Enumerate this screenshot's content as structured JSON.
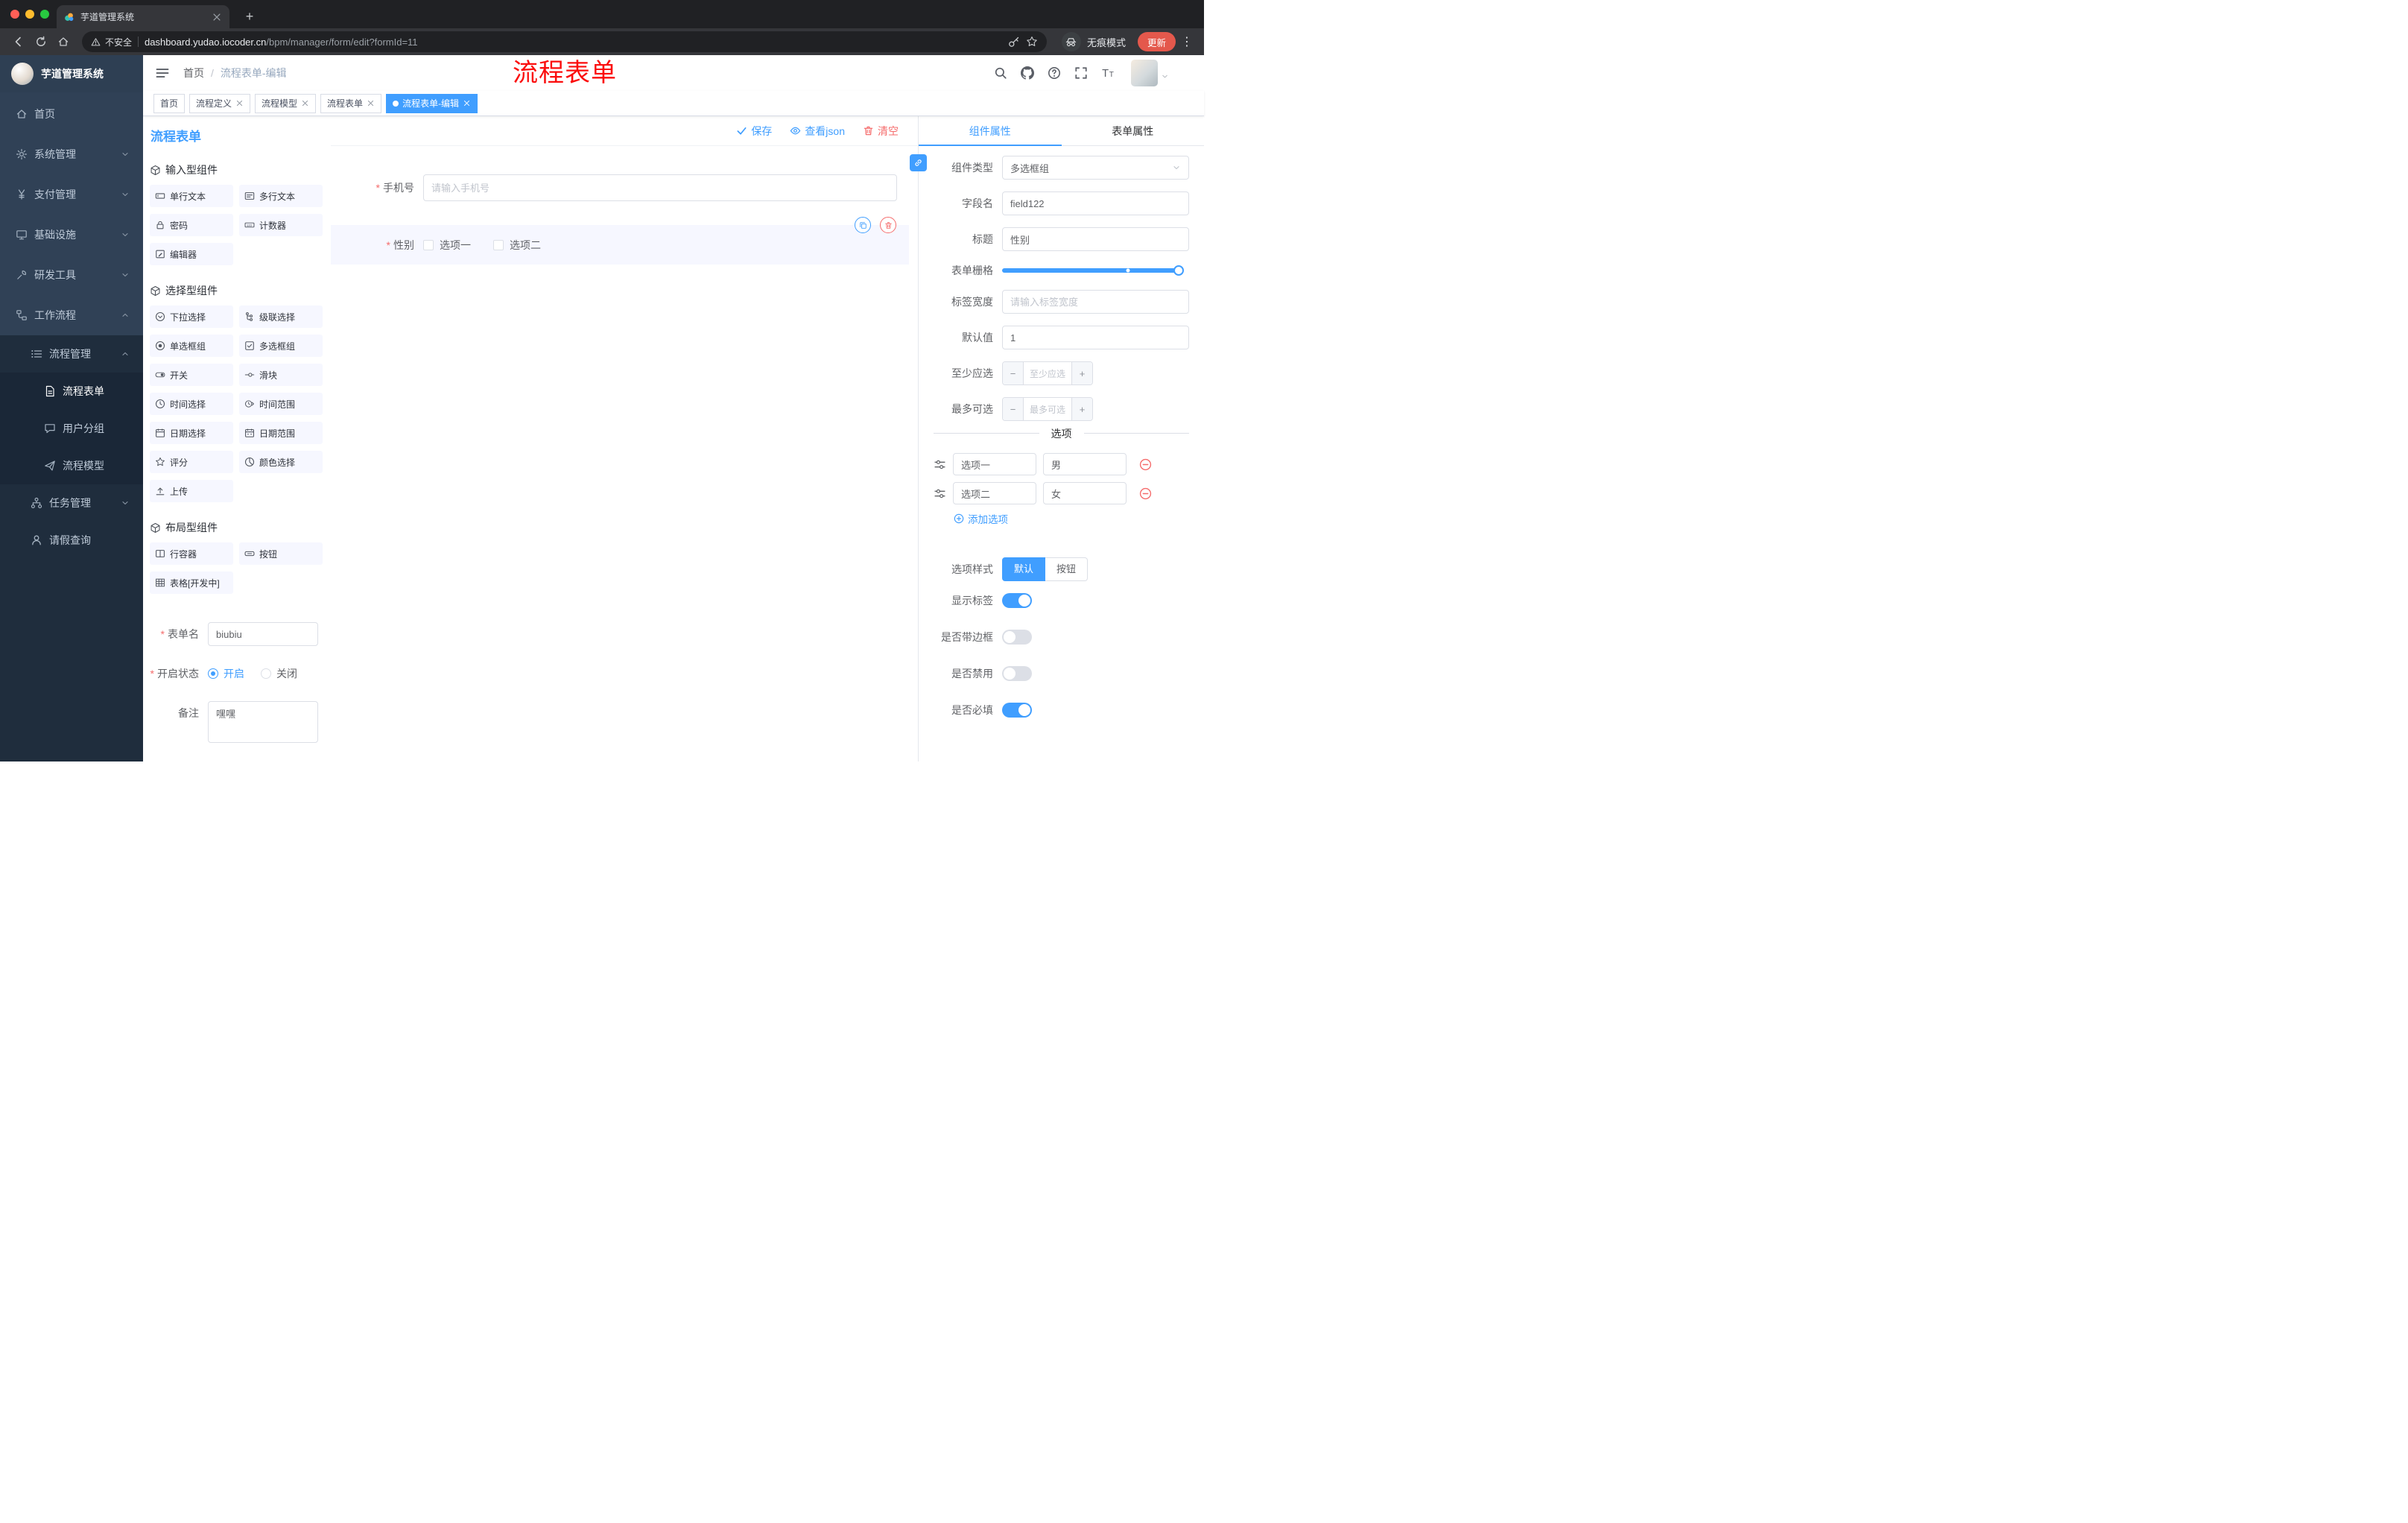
{
  "colors": {
    "primary": "#409eff",
    "danger": "#f56c6c",
    "sidebar": "#304156"
  },
  "browser": {
    "tab_title": "芋道管理系统",
    "security": "不安全",
    "url_domain": "dashboard.yudao.iocoder.cn",
    "url_path": "/bpm/manager/form/edit?formId=11",
    "incognito": "无痕模式",
    "update": "更新"
  },
  "sidebar": {
    "logo": "芋道管理系统",
    "items": [
      {
        "label": "首页",
        "icon": "home-icon"
      },
      {
        "label": "系统管理",
        "icon": "gear-icon"
      },
      {
        "label": "支付管理",
        "icon": "yen-icon"
      },
      {
        "label": "基础设施",
        "icon": "monitor-icon"
      },
      {
        "label": "研发工具",
        "icon": "tool-icon"
      },
      {
        "label": "工作流程",
        "icon": "workflow-icon"
      },
      {
        "label": "流程管理",
        "icon": "list-icon"
      },
      {
        "label": "流程表单",
        "icon": "document-icon",
        "active": true
      },
      {
        "label": "用户分组",
        "icon": "chat-icon"
      },
      {
        "label": "流程模型",
        "icon": "send-icon"
      },
      {
        "label": "任务管理",
        "icon": "hierarchy-icon"
      },
      {
        "label": "请假查询",
        "icon": "user-icon"
      }
    ]
  },
  "header": {
    "breadcrumb": {
      "home": "首页",
      "separator": "/",
      "current": "流程表单-编辑"
    },
    "annotation": "流程表单"
  },
  "tags": [
    {
      "label": "首页"
    },
    {
      "label": "流程定义"
    },
    {
      "label": "流程模型"
    },
    {
      "label": "流程表单"
    },
    {
      "label": "流程表单-编辑",
      "active": true
    }
  ],
  "palette": {
    "title": "流程表单",
    "sections": [
      {
        "title": "输入型组件",
        "items": [
          {
            "label": "单行文本",
            "icon": "input-icon"
          },
          {
            "label": "多行文本",
            "icon": "textarea-icon"
          },
          {
            "label": "密码",
            "icon": "lock-icon"
          },
          {
            "label": "计数器",
            "icon": "counter-icon"
          },
          {
            "label": "编辑器",
            "icon": "editor-icon"
          }
        ]
      },
      {
        "title": "选择型组件",
        "items": [
          {
            "label": "下拉选择",
            "icon": "select-icon"
          },
          {
            "label": "级联选择",
            "icon": "cascader-icon"
          },
          {
            "label": "单选框组",
            "icon": "radio-icon"
          },
          {
            "label": "多选框组",
            "icon": "checkbox-icon"
          },
          {
            "label": "开关",
            "icon": "switch-icon"
          },
          {
            "label": "滑块",
            "icon": "slider-icon"
          },
          {
            "label": "时间选择",
            "icon": "time-icon"
          },
          {
            "label": "时间范围",
            "icon": "time-range-icon"
          },
          {
            "label": "日期选择",
            "icon": "date-icon"
          },
          {
            "label": "日期范围",
            "icon": "date-range-icon"
          },
          {
            "label": "评分",
            "icon": "star-icon"
          },
          {
            "label": "颜色选择",
            "icon": "color-icon"
          },
          {
            "label": "上传",
            "icon": "upload-icon"
          }
        ]
      },
      {
        "title": "布局型组件",
        "items": [
          {
            "label": "行容器",
            "icon": "row-icon"
          },
          {
            "label": "按钮",
            "icon": "button-icon"
          },
          {
            "label": "表格[开发中]",
            "icon": "table-icon"
          }
        ]
      }
    ],
    "form": {
      "name_label": "表单名",
      "name_value": "biubiu",
      "status_label": "开启状态",
      "status_on": "开启",
      "status_off": "关闭",
      "remark_label": "备注",
      "remark_value": "嘿嘿"
    }
  },
  "canvas": {
    "save": "保存",
    "view_json": "查看json",
    "clear": "清空",
    "phone": {
      "label": "手机号",
      "placeholder": "请输入手机号"
    },
    "gender": {
      "label": "性别",
      "option1": "选项一",
      "option2": "选项二"
    }
  },
  "props": {
    "tab_component": "组件属性",
    "tab_form": "表单属性",
    "component_type": {
      "label": "组件类型",
      "value": "多选框组"
    },
    "field_name": {
      "label": "字段名",
      "value": "field122"
    },
    "title": {
      "label": "标题",
      "value": "性别"
    },
    "grid": {
      "label": "表单栅格"
    },
    "label_width": {
      "label": "标签宽度",
      "placeholder": "请输入标签宽度"
    },
    "default_value": {
      "label": "默认值",
      "value": "1"
    },
    "min_select": {
      "label": "至少应选",
      "placeholder": "至少应选",
      "minus": "−",
      "plus": "+"
    },
    "max_select": {
      "label": "最多可选",
      "placeholder": "最多可选",
      "minus": "−",
      "plus": "+"
    },
    "options_title": "选项",
    "options": [
      {
        "name": "选项一",
        "value": "男"
      },
      {
        "name": "选项二",
        "value": "女"
      }
    ],
    "add_option": "添加选项",
    "option_style": {
      "label": "选项样式",
      "default": "默认",
      "button": "按钮"
    },
    "toggles": [
      {
        "label": "显示标签",
        "on": true
      },
      {
        "label": "是否带边框",
        "on": false
      },
      {
        "label": "是否禁用",
        "on": false
      },
      {
        "label": "是否必填",
        "on": true
      }
    ]
  }
}
